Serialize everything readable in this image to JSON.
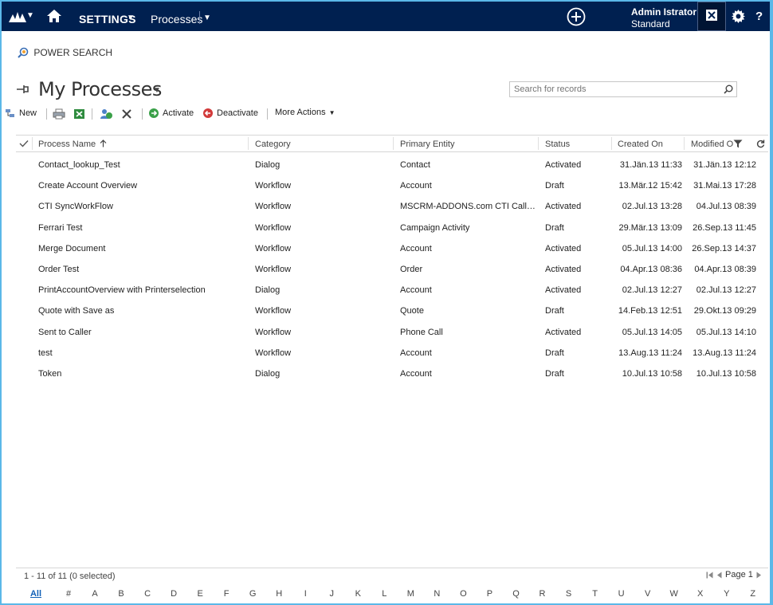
{
  "nav": {
    "area": "SETTINGS",
    "entity": "Processes",
    "user_name": "Admin Istrator",
    "user_role": "Standard",
    "help": "?"
  },
  "power_search": "POWER SEARCH",
  "view": {
    "title": "My Processes",
    "search_placeholder": "Search for records"
  },
  "toolbar": {
    "new": "New",
    "activate": "Activate",
    "deactivate": "Deactivate",
    "more_actions": "More Actions"
  },
  "columns": {
    "name": "Process Name",
    "category": "Category",
    "entity": "Primary Entity",
    "status": "Status",
    "created": "Created On",
    "modified": "Modified O"
  },
  "rows": [
    {
      "name": "Contact_lookup_Test",
      "category": "Dialog",
      "entity": "Contact",
      "status": "Activated",
      "created": "31.Jän.13 11:33",
      "modified": "31.Jän.13 12:12"
    },
    {
      "name": "Create Account Overview",
      "category": "Workflow",
      "entity": "Account",
      "status": "Draft",
      "created": "13.Mär.12 15:42",
      "modified": "31.Mai.13 17:28"
    },
    {
      "name": "CTI SyncWorkFlow",
      "category": "Workflow",
      "entity": "MSCRM-ADDONS.com CTI Call Histo...",
      "status": "Activated",
      "created": "02.Jul.13 13:28",
      "modified": "04.Jul.13 08:39"
    },
    {
      "name": "Ferrari Test",
      "category": "Workflow",
      "entity": "Campaign Activity",
      "status": "Draft",
      "created": "29.Mär.13 13:09",
      "modified": "26.Sep.13 11:45"
    },
    {
      "name": "Merge Document",
      "category": "Workflow",
      "entity": "Account",
      "status": "Activated",
      "created": "05.Jul.13 14:00",
      "modified": "26.Sep.13 14:37"
    },
    {
      "name": "Order Test",
      "category": "Workflow",
      "entity": "Order",
      "status": "Activated",
      "created": "04.Apr.13 08:36",
      "modified": "04.Apr.13 08:39"
    },
    {
      "name": "PrintAccountOverview with Printerselection",
      "category": "Dialog",
      "entity": "Account",
      "status": "Activated",
      "created": "02.Jul.13 12:27",
      "modified": "02.Jul.13 12:27"
    },
    {
      "name": "Quote with Save as",
      "category": "Workflow",
      "entity": "Quote",
      "status": "Draft",
      "created": "14.Feb.13 12:51",
      "modified": "29.Okt.13 09:29"
    },
    {
      "name": "Sent to Caller",
      "category": "Workflow",
      "entity": "Phone Call",
      "status": "Activated",
      "created": "05.Jul.13 14:05",
      "modified": "05.Jul.13 14:10"
    },
    {
      "name": "test",
      "category": "Workflow",
      "entity": "Account",
      "status": "Draft",
      "created": "13.Aug.13 11:24",
      "modified": "13.Aug.13 11:24"
    },
    {
      "name": "Token",
      "category": "Dialog",
      "entity": "Account",
      "status": "Draft",
      "created": "10.Jul.13 10:58",
      "modified": "10.Jul.13 10:58"
    }
  ],
  "footer": {
    "count": "1 - 11 of 11 (0 selected)",
    "page": "Page 1"
  },
  "alphabet": [
    "All",
    "#",
    "A",
    "B",
    "C",
    "D",
    "E",
    "F",
    "G",
    "H",
    "I",
    "J",
    "K",
    "L",
    "M",
    "N",
    "O",
    "P",
    "Q",
    "R",
    "S",
    "T",
    "U",
    "V",
    "W",
    "X",
    "Y",
    "Z"
  ],
  "alphabet_selected": "All",
  "colors": {
    "nav_bg": "#002050",
    "frame_border": "#5bb8e8",
    "link": "#1160b7"
  }
}
